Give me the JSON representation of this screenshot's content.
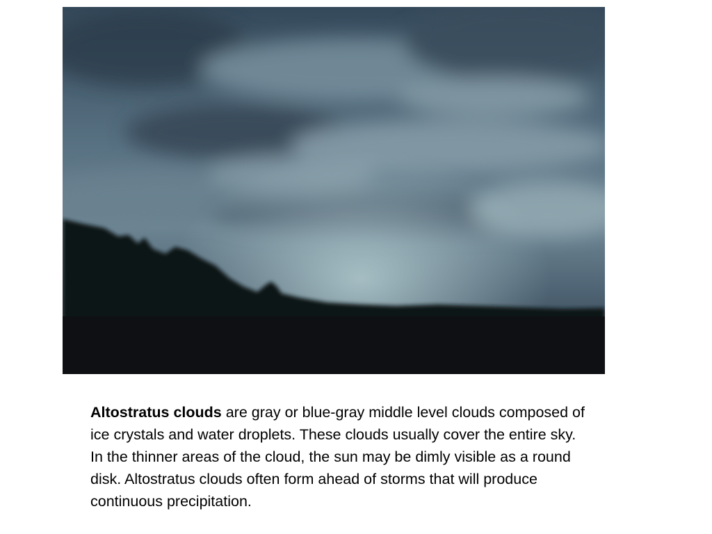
{
  "caption": {
    "term": "Altostratus clouds",
    "text": " are gray or blue-gray middle level clouds composed of ice crystals and water droplets. These clouds usually cover the entire sky. In the thinner areas of the cloud, the sun may be dimly visible as a round disk. Altostratus clouds often form ahead of storms that will produce continuous precipitation."
  },
  "colors": {
    "sky_dark": "#2f4150",
    "sky_mid": "#5a7384",
    "sky_light": "#8fa5b0",
    "horizon_glow": "#a8c4c9",
    "silhouette": "#0f1114"
  }
}
